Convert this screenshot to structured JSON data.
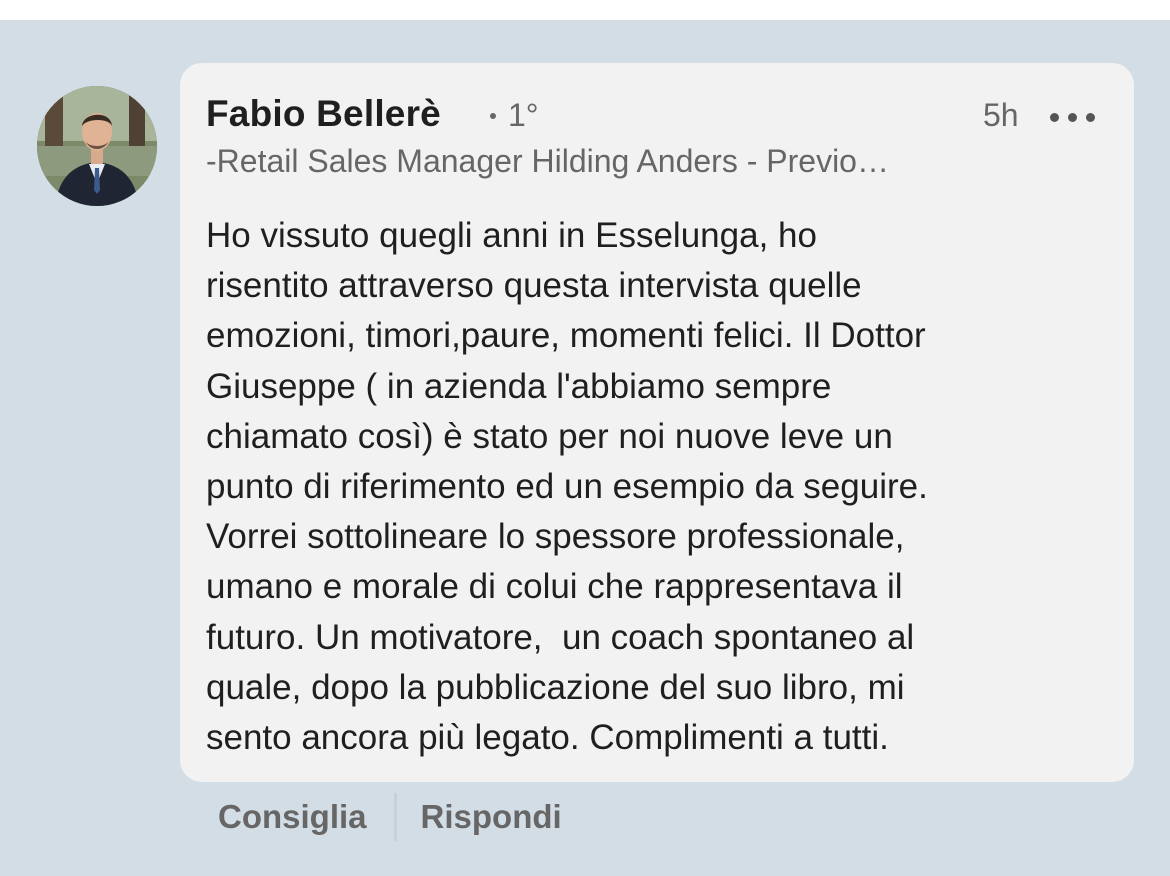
{
  "comment": {
    "author": {
      "name": "Fabio Bellerè",
      "connection_degree": "1°",
      "headline": "-Retail Sales Manager Hilding Anders - Previo…"
    },
    "timestamp": "5h",
    "more_icon": "more-horizontal-icon",
    "text_lines": [
      "Ho vissuto quegli anni in Esselunga, ho",
      "risentito attraverso questa intervista quelle",
      "emozioni, timori,paure, momenti felici. Il Dottor",
      "Giuseppe ( in azienda l'abbiamo sempre",
      "chiamato così) è stato per noi nuove leve un",
      "punto di riferimento ed un esempio da seguire.",
      "Vorrei sottolineare lo spessore professionale,",
      "umano e morale di colui che rappresentava il",
      "futuro. Un motivatore,  un coach spontaneo al",
      "quale, dopo la pubblicazione del suo libro, mi",
      "sento ancora più legato. Complimenti a tutti."
    ]
  },
  "actions": {
    "like_label": "Consiglia",
    "reply_label": "Rispondi"
  },
  "colors": {
    "background": "#d3dde6",
    "bubble": "#f2f2f2",
    "primary_text": "#1f1f1f",
    "secondary_text": "#666666"
  }
}
